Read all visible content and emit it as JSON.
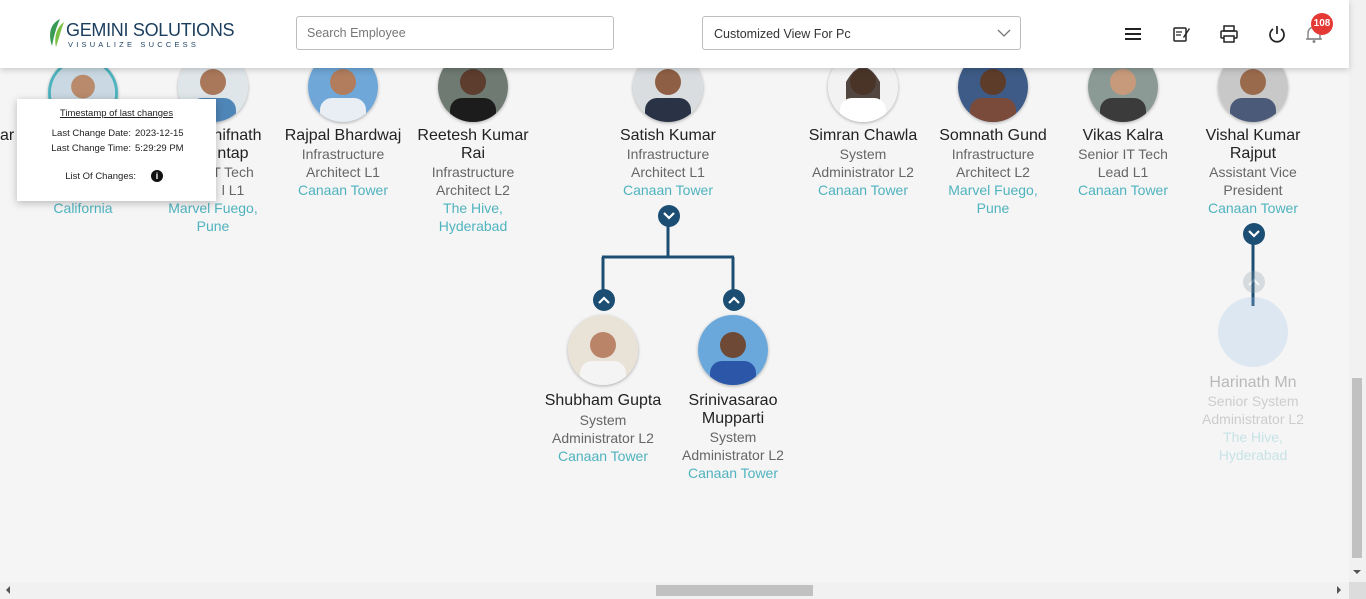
{
  "header": {
    "logo_title": "GEMINI SOLUTIONS",
    "logo_subtitle": "VISUALIZE SUCCESS",
    "search_placeholder": "Search Employee",
    "view_select_value": "Customized View For Pc",
    "notification_count": "108",
    "icons": [
      "menu-icon",
      "edit-note-icon",
      "print-icon",
      "power-icon",
      "bell-icon"
    ]
  },
  "popup": {
    "title": "Timestamp of last changes",
    "date_label": "Last Change Date:",
    "date_value": "2023-12-15",
    "time_label": "Last Change Time:",
    "time_value": "5:29:29 PM",
    "changes_label": "List Of Changes:"
  },
  "top_row": [
    {
      "name": "",
      "role_lines": [],
      "location_lines": [
        "California"
      ]
    },
    {
      "name_lines": [
        "anifnath",
        "ntap"
      ],
      "role_lines": [
        "T Tech",
        "l L1"
      ],
      "location_lines": [
        "Marvel Fuego,",
        "Pune"
      ]
    },
    {
      "name_lines": [
        "Rajpal Bhardwaj"
      ],
      "role_lines": [
        "Infrastructure",
        "Architect L1"
      ],
      "location_lines": [
        "Canaan Tower"
      ]
    },
    {
      "name_lines": [
        "Reetesh Kumar",
        "Rai"
      ],
      "role_lines": [
        "Infrastructure",
        "Architect L2"
      ],
      "location_lines": [
        "The Hive,",
        "Hyderabad"
      ]
    },
    {
      "name_lines": [
        "Satish Kumar"
      ],
      "role_lines": [
        "Infrastructure",
        "Architect L1"
      ],
      "location_lines": [
        "Canaan Tower"
      ]
    },
    {
      "name_lines": [
        "Simran Chawla"
      ],
      "role_lines": [
        "System",
        "Administrator L2"
      ],
      "location_lines": [
        "Canaan Tower"
      ]
    },
    {
      "name_lines": [
        "Somnath Gund"
      ],
      "role_lines": [
        "Infrastructure",
        "Architect L2"
      ],
      "location_lines": [
        "Marvel Fuego,",
        "Pune"
      ]
    },
    {
      "name_lines": [
        "Vikas Kalra"
      ],
      "role_lines": [
        "Senior IT Tech",
        "Lead L1"
      ],
      "location_lines": [
        "Canaan Tower"
      ]
    },
    {
      "name_lines": [
        "Vishal Kumar",
        "Rajput"
      ],
      "role_lines": [
        "Assistant Vice",
        "President"
      ],
      "location_lines": [
        "Canaan Tower"
      ]
    }
  ],
  "edge_fragment": "ar",
  "children": [
    {
      "name_lines": [
        "Shubham Gupta"
      ],
      "role_lines": [
        "System",
        "Administrator L2"
      ],
      "location_lines": [
        "Canaan Tower"
      ]
    },
    {
      "name_lines": [
        "Srinivasarao",
        "Mupparti"
      ],
      "role_lines": [
        "System",
        "Administrator L2"
      ],
      "location_lines": [
        "Canaan Tower"
      ]
    },
    {
      "name_lines": [
        "Harinath Mn"
      ],
      "role_lines": [
        "Senior System",
        "Administrator L2"
      ],
      "location_lines": [
        "The Hive,",
        "Hyderabad"
      ]
    }
  ],
  "colors": {
    "accent": "#1c4e73",
    "location": "#4fb3bf",
    "badge": "#e53935"
  }
}
